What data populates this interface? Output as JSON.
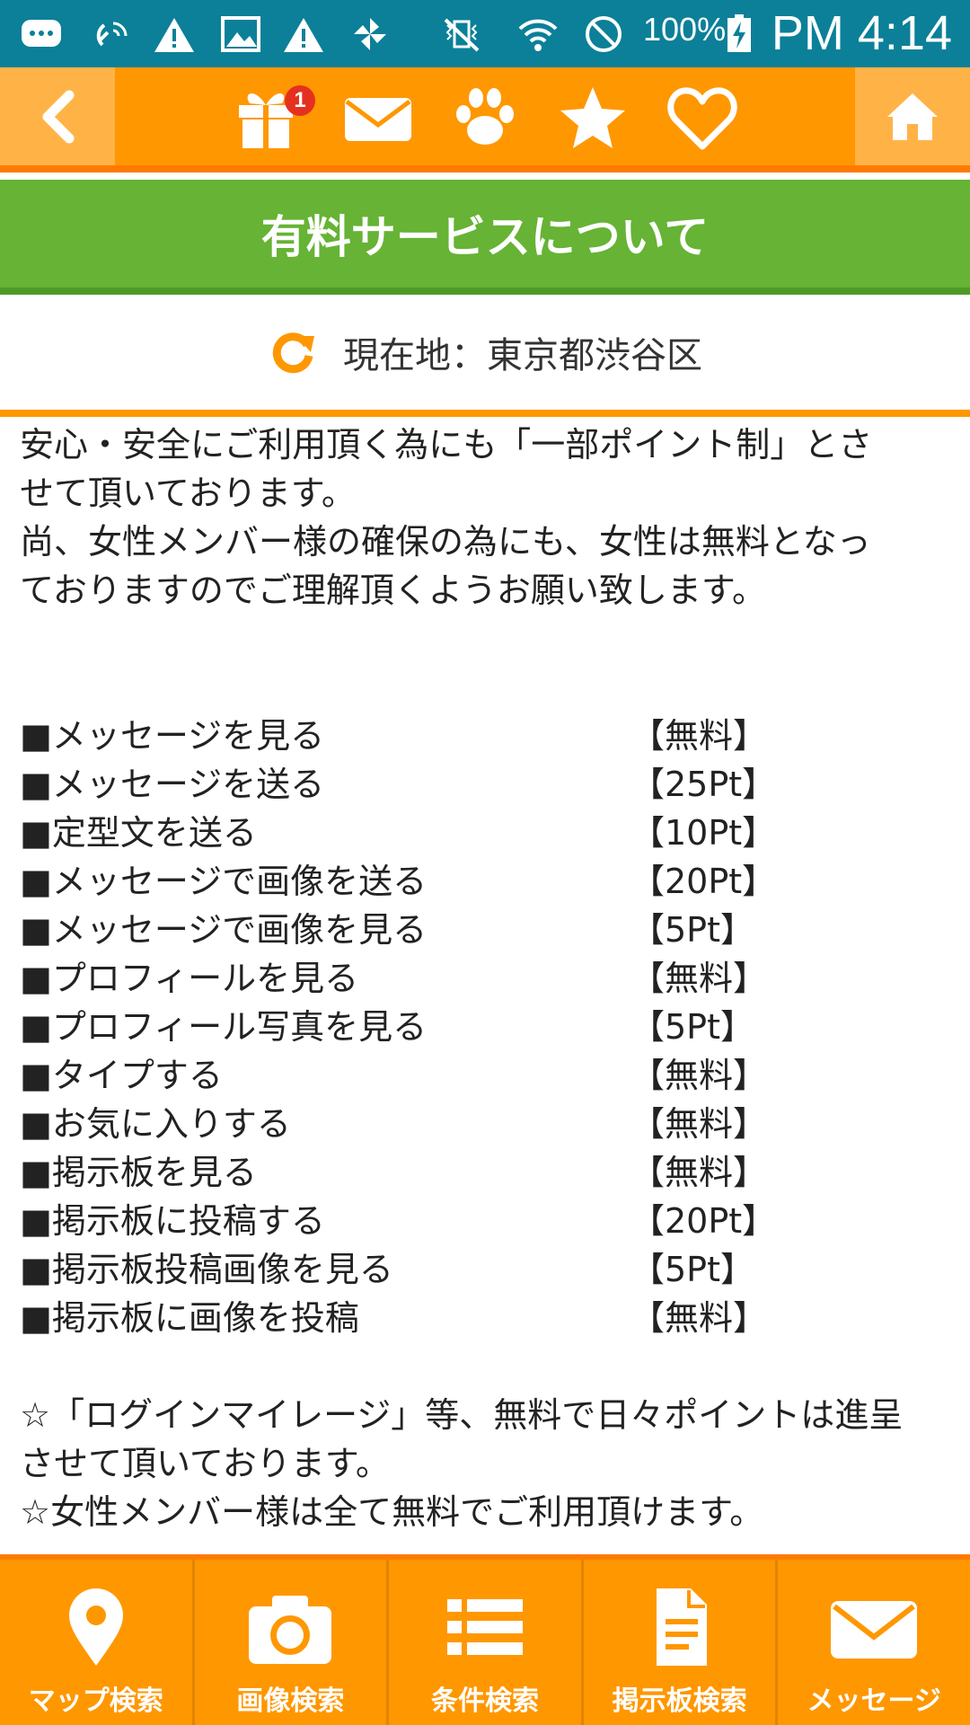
{
  "status_bar": {
    "battery": "100%",
    "time": "PM 4:14"
  },
  "top_nav": {
    "notification_count": "1",
    "icons": [
      "back-arrow-icon",
      "gift-icon",
      "mail-icon",
      "paw-icon",
      "star-icon",
      "heart-icon",
      "home-icon"
    ]
  },
  "title": "有料サービスについて",
  "location": {
    "label": "現在地：東京都渋谷区"
  },
  "intro": {
    "line1": "安心・安全にご利用頂く為にも「一部ポイント制」とさ",
    "line2": "せて頂いております。",
    "line3": "尚、女性メンバー様の確保の為にも、女性は無料となっ",
    "line4": "ておりますのでご理解頂くようお願い致します。"
  },
  "prices": [
    {
      "item": "■メッセージを見る",
      "cost": "【無料】"
    },
    {
      "item": "■メッセージを送る",
      "cost": "【25Pt】"
    },
    {
      "item": "■定型文を送る",
      "cost": "【10Pt】"
    },
    {
      "item": "■メッセージで画像を送る",
      "cost": "【20Pt】"
    },
    {
      "item": "■メッセージで画像を見る",
      "cost": "【5Pt】"
    },
    {
      "item": "■プロフィールを見る",
      "cost": "【無料】"
    },
    {
      "item": "■プロフィール写真を見る",
      "cost": "【5Pt】"
    },
    {
      "item": "■タイプする",
      "cost": "【無料】"
    },
    {
      "item": "■お気に入りする",
      "cost": "【無料】"
    },
    {
      "item": "■掲示板を見る",
      "cost": "【無料】"
    },
    {
      "item": "■掲示板に投稿する",
      "cost": "【20Pt】"
    },
    {
      "item": "■掲示板投稿画像を見る",
      "cost": "【5Pt】"
    },
    {
      "item": "■掲示板に画像を投稿",
      "cost": "【無料】"
    }
  ],
  "notes": {
    "line1": "☆「ログインマイレージ」等、無料で日々ポイントは進呈",
    "line2": "させて頂いております。",
    "line3": "☆女性メンバー様は全て無料でご利用頂けます。"
  },
  "bottom_nav": [
    {
      "label": "マップ検索",
      "icon": "map-pin-icon"
    },
    {
      "label": "画像検索",
      "icon": "camera-icon"
    },
    {
      "label": "条件検索",
      "icon": "list-icon"
    },
    {
      "label": "掲示板検索",
      "icon": "document-icon"
    },
    {
      "label": "メッセージ",
      "icon": "mail-icon"
    }
  ],
  "colors": {
    "status_bar": "#0b8098",
    "accent_orange": "#ff9700",
    "title_green": "#66b335"
  }
}
